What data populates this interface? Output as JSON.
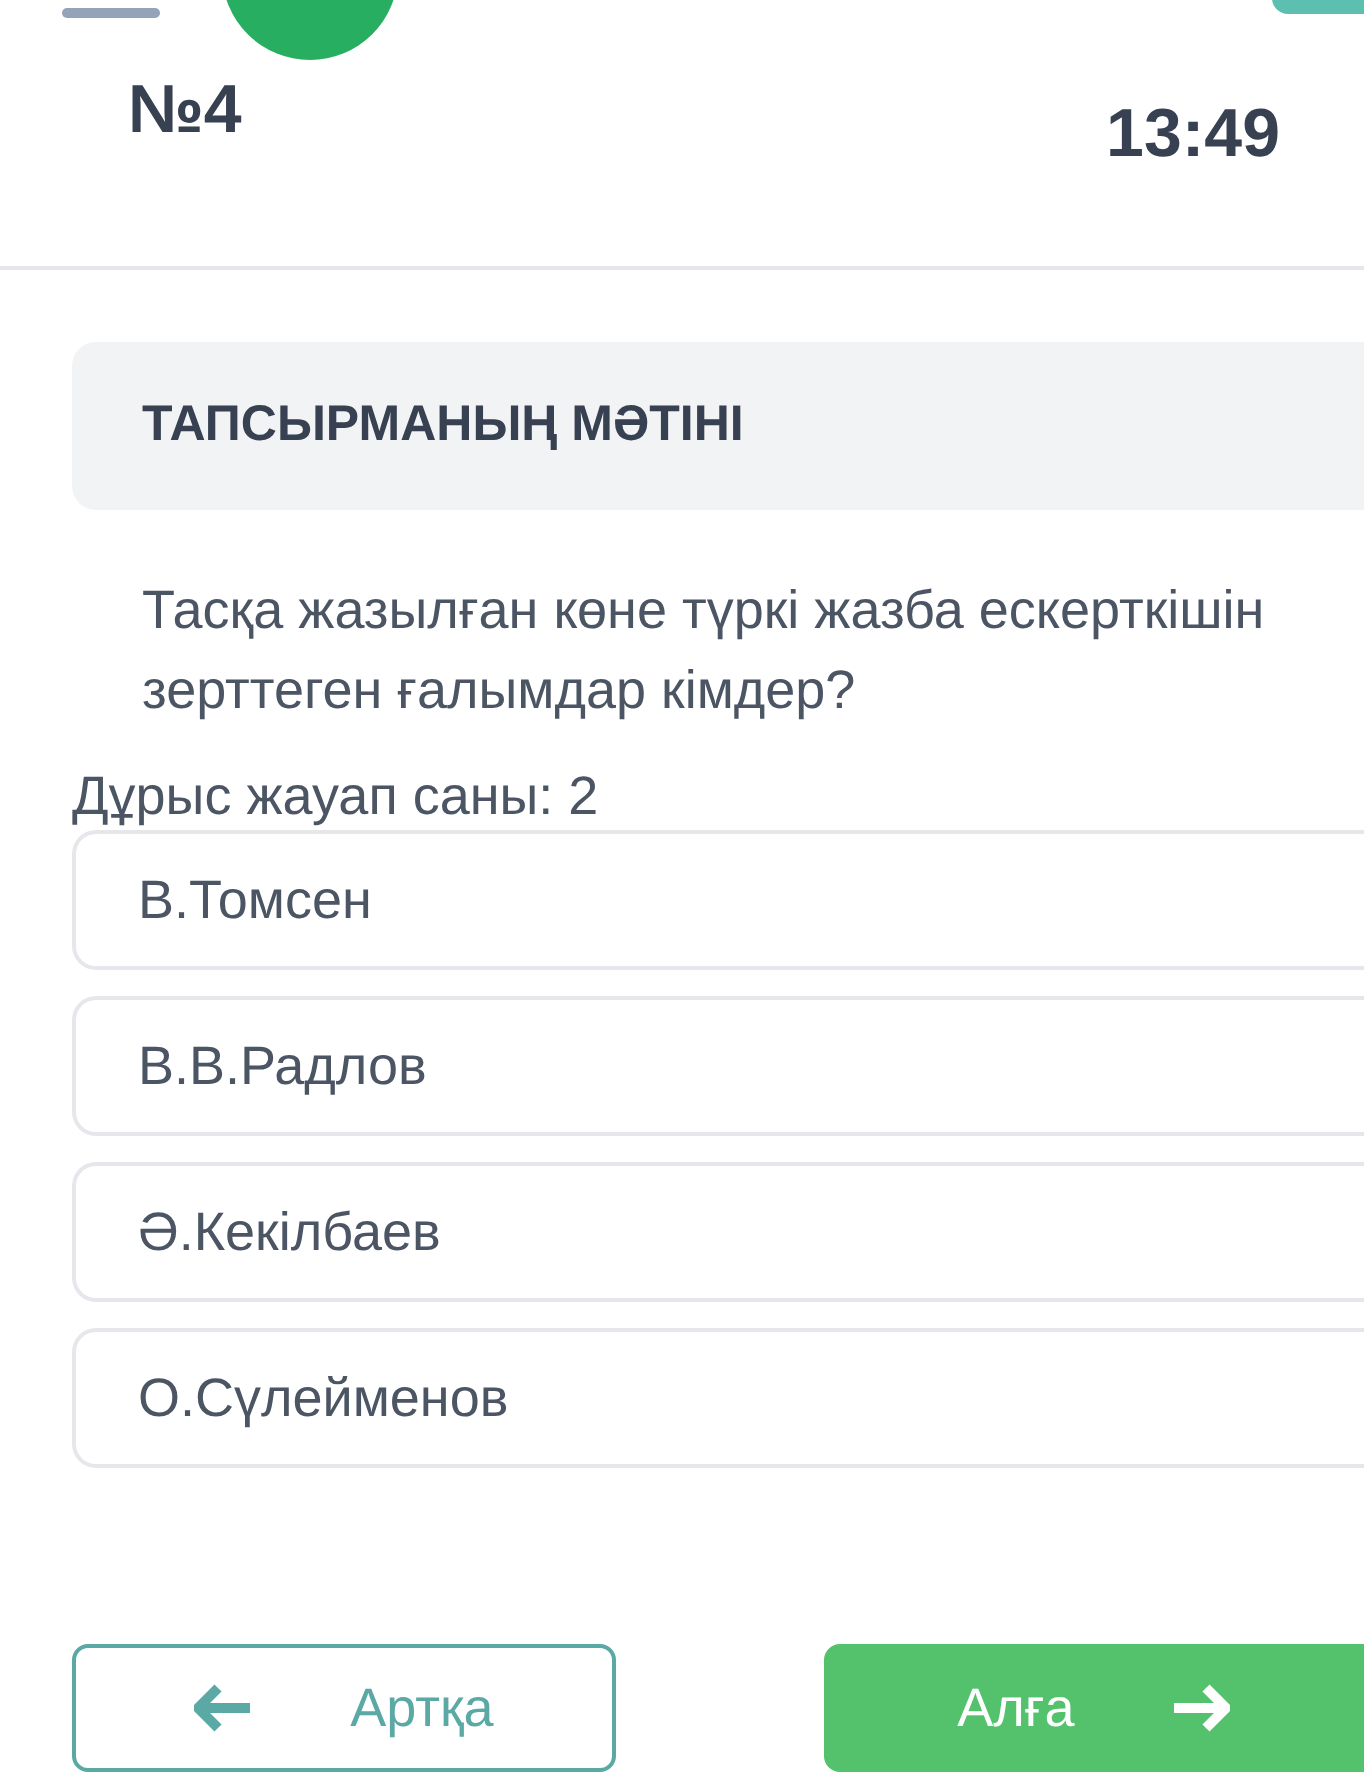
{
  "header": {
    "number": "№4",
    "timer": "13:49"
  },
  "task": {
    "heading": "ТАПСЫРМАНЫҢ МӘТІНІ",
    "question": "Тасқа жазылған көне түркі жазба ескерткішін зерттеген ғалымдар кімдер?",
    "answer_count": "Дұрыс жауап саны: 2"
  },
  "options": [
    {
      "label": "В.Томсен",
      "selected": false
    },
    {
      "label": "В.В.Радлов",
      "selected": false
    },
    {
      "label": "Ә.Кекілбаев",
      "selected": false
    },
    {
      "label": "О.Сүлейменов",
      "selected": false
    }
  ],
  "buttons": {
    "back": "Артқа",
    "next": "Алға"
  }
}
